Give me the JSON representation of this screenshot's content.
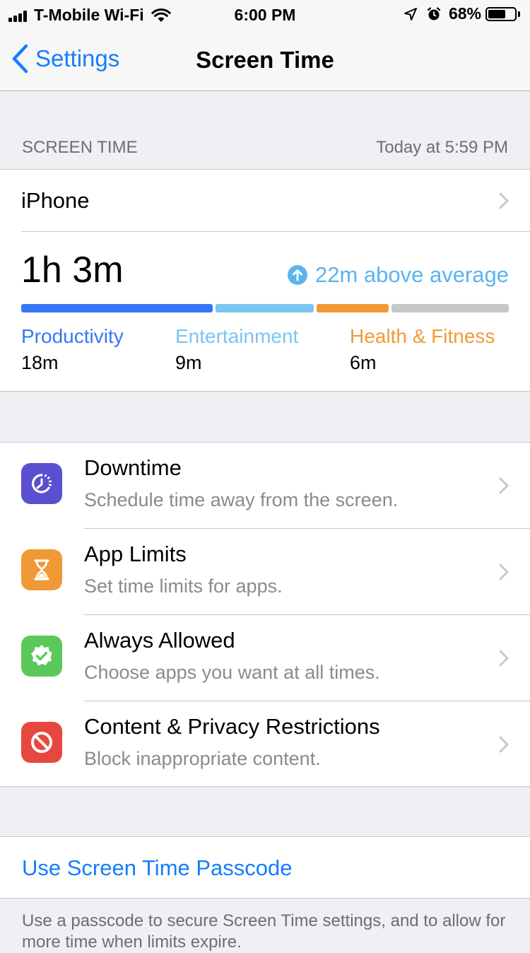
{
  "status_bar": {
    "carrier": "T-Mobile Wi-Fi",
    "time": "6:00 PM",
    "battery_percent": "68%",
    "battery_level": 0.68,
    "icons": [
      "signal-icon",
      "wifi-icon",
      "location-icon",
      "alarm-icon",
      "battery-icon"
    ]
  },
  "nav": {
    "back_label": "Settings",
    "title": "Screen Time"
  },
  "section": {
    "header": "SCREEN TIME",
    "updated": "Today at 5:59 PM"
  },
  "usage": {
    "device": "iPhone",
    "total": "1h 3m",
    "trend_label": "22m above average",
    "categories": [
      {
        "name": "Productivity",
        "time": "18m",
        "color": "#3478f6",
        "share": 0.4
      },
      {
        "name": "Entertainment",
        "time": "9m",
        "color": "#7ac5f2",
        "share": 0.205
      },
      {
        "name": "Health & Fitness",
        "time": "6m",
        "color": "#f09a37",
        "share": 0.15
      }
    ],
    "other_color": "#c7c7cc",
    "other_share": 0.245
  },
  "options": [
    {
      "title": "Downtime",
      "subtitle": "Schedule time away from the screen.",
      "icon": "downtime-icon",
      "color": "#5a4fcf"
    },
    {
      "title": "App Limits",
      "subtitle": "Set time limits for apps.",
      "icon": "hourglass-icon",
      "color": "#f09a37"
    },
    {
      "title": "Always Allowed",
      "subtitle": "Choose apps you want at all times.",
      "icon": "checkmark-badge-icon",
      "color": "#5ac85a"
    },
    {
      "title": "Content & Privacy Restrictions",
      "subtitle": "Block inappropriate content.",
      "icon": "restricted-icon",
      "color": "#e8473f"
    }
  ],
  "passcode": {
    "label": "Use Screen Time Passcode",
    "footer": "Use a passcode to secure Screen Time settings, and to allow for more time when limits expire."
  },
  "colors": {
    "accent": "#157efb",
    "background": "#efeff4",
    "secondary_text": "#8a8a8f"
  }
}
